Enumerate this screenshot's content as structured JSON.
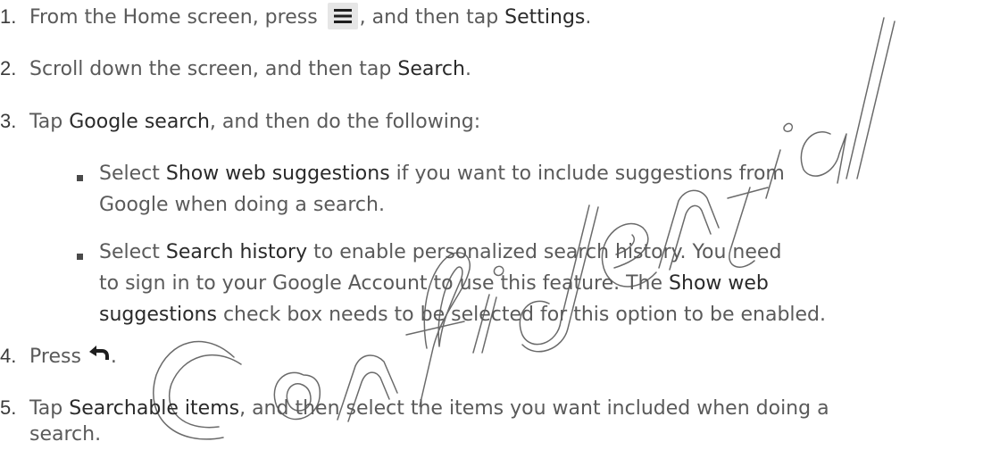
{
  "steps": [
    {
      "number": "1.",
      "t1": "From the Home screen, press",
      "t2": ", and then tap",
      "ui1": "Settings",
      "t3": ".",
      "icon": "menu-icon"
    },
    {
      "number": "2.",
      "t1": "Scroll down the screen, and then tap",
      "ui1": "Search",
      "t2": "."
    },
    {
      "number": "3.",
      "t1": "Tap",
      "ui1": "Google search",
      "t2": ", and then do the following:"
    },
    {
      "number": "4.",
      "t1": "Press",
      "t2": ".",
      "icon": "back-arrow-icon"
    },
    {
      "number": "5.",
      "t1": "Tap",
      "ui1": "Searchable items",
      "t2": ", and then select the items you want included when doing a",
      "t3": "search."
    }
  ],
  "bullets": [
    {
      "t1": "Select",
      "ui1": "Show web suggestions",
      "t2": "if you want to include suggestions from",
      "t3": "Google when doing a search."
    },
    {
      "t1": "Select",
      "ui1": "Search history",
      "t2": "to enable personalized search history. You need",
      "t3": "to sign in to your Google Account to use this feature. The",
      "ui2": "Show web",
      "ui3": "suggestions",
      "t4": "check box needs to be selected for this option to be enabled."
    }
  ],
  "watermark": "Confidential"
}
